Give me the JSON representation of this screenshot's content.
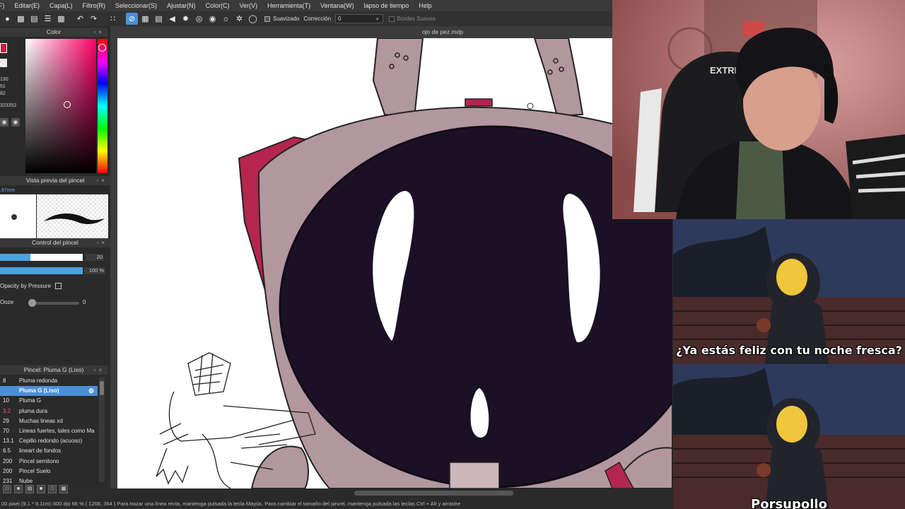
{
  "menu": [
    "F)",
    "Editar(E)",
    "Capa(L)",
    "Filtro(R)",
    "Seleccionar(S)",
    "Ajustar(N)",
    "Color(C)",
    "Ver(V)",
    "Herramienta(T)",
    "Ventana(W)",
    "lapso de tiempo",
    "Help"
  ],
  "toolbar": {
    "antialias_label": "Suavizado",
    "correction_label": "Corrección",
    "correction_value": "0",
    "soft_edges_label": "Bordes Suaves"
  },
  "color_panel": {
    "title": "Color",
    "r": "130",
    "g": "51",
    "b": "82",
    "hex": "323352",
    "main_color": "#c8213f"
  },
  "brush_preview": {
    "title": "Vista previa del pincel",
    "size": ".87mm"
  },
  "brush_control": {
    "title": "Control del pincel",
    "size_value": "20",
    "size_fraction": 0.37,
    "opacity_value": "100 %",
    "opacity_fraction": 1.0,
    "opacity_pressure_label": "Opacity by Pressure",
    "ooze_label": "Ooze",
    "ooze_value": "0"
  },
  "brush_list": {
    "title": "Pincel: Pluma G (Liso)",
    "items": [
      {
        "size": "8",
        "name": "Pluma redonda"
      },
      {
        "size": "",
        "name": "Pluma G (Liso)",
        "selected": true
      },
      {
        "size": "10",
        "name": "Pluma G"
      },
      {
        "size": "3.2",
        "name": "pluma dura"
      },
      {
        "size": "29",
        "name": "Muchas lineas xd"
      },
      {
        "size": "70",
        "name": "Lineas fuertes, tales como Ma"
      },
      {
        "size": "13.1",
        "name": "Cepillo redondo (acuoso)"
      },
      {
        "size": "6.5",
        "name": "lineart de fondos"
      },
      {
        "size": "200",
        "name": "Pincel semitono"
      },
      {
        "size": "200",
        "name": "Pincel Suelo"
      },
      {
        "size": "231",
        "name": "Nube"
      }
    ]
  },
  "canvas": {
    "file_title": "ojo de pez.mdp"
  },
  "status": {
    "text": "00 pixel  (9.1 * 9.1cm)  600 dpi  66 %  ( 1206, 394 )  Para trazar una línea recta, mantenga pulsada la tecla Mayús. Para cambiar el tamaño del pincel, mantenga pulsada las teclas Ctrl + Alt y arrastre"
  },
  "webcam": {
    "chair_brand": "EXTRE"
  },
  "meme": {
    "caption_top": "¿Ya estás feliz con tu noche fresca?",
    "caption_bottom": "Porsupollo"
  },
  "colors": {
    "accent": "#4a90d9",
    "helmet": "#b2979e",
    "visor": "#1a1224",
    "magenta": "#b4264e"
  }
}
